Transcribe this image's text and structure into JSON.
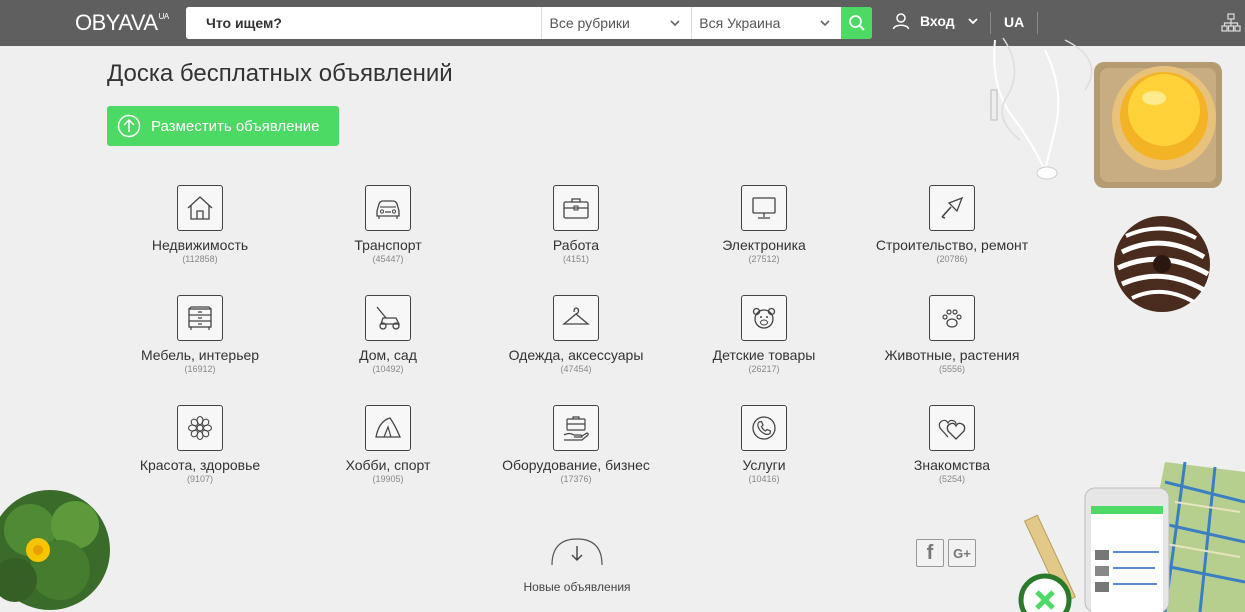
{
  "header": {
    "logo_text": "OBYAVA",
    "logo_sup": "UA",
    "search_placeholder": "Что ищем?",
    "rubric_select": "Все рубрики",
    "region_select": "Вся Украина",
    "login_label": "Вход",
    "lang_label": "UA"
  },
  "main": {
    "title": "Доска бесплатных объявлений",
    "post_button": "Разместить объявление"
  },
  "categories": [
    {
      "name": "Недвижимость",
      "count": "(112858)",
      "icon": "house-icon"
    },
    {
      "name": "Транспорт",
      "count": "(45447)",
      "icon": "car-icon"
    },
    {
      "name": "Работа",
      "count": "(4151)",
      "icon": "briefcase-icon"
    },
    {
      "name": "Электроника",
      "count": "(27512)",
      "icon": "monitor-icon"
    },
    {
      "name": "Строительство, ремонт",
      "count": "(20786)",
      "icon": "trowel-icon"
    },
    {
      "name": "Мебель, интерьер",
      "count": "(16912)",
      "icon": "dresser-icon"
    },
    {
      "name": "Дом, сад",
      "count": "(10492)",
      "icon": "lawnmower-icon"
    },
    {
      "name": "Одежда, аксессуары",
      "count": "(47454)",
      "icon": "hanger-icon"
    },
    {
      "name": "Детские товары",
      "count": "(26217)",
      "icon": "teddy-bear-icon"
    },
    {
      "name": "Животные, растения",
      "count": "(5556)",
      "icon": "paw-icon"
    },
    {
      "name": "Красота, здоровье",
      "count": "(9107)",
      "icon": "flower-icon"
    },
    {
      "name": "Хобби, спорт",
      "count": "(19905)",
      "icon": "tent-icon"
    },
    {
      "name": "Оборудование, бизнес",
      "count": "(17376)",
      "icon": "business-case-icon"
    },
    {
      "name": "Услуги",
      "count": "(10416)",
      "icon": "phone-icon"
    },
    {
      "name": "Знакомства",
      "count": "(5254)",
      "icon": "hearts-icon"
    }
  ],
  "footer": {
    "new_ads_label": "Новые объявления",
    "facebook_glyph": "f",
    "google_glyph": "G+"
  },
  "colors": {
    "header_bg": "#5f5f5f",
    "accent_green": "#4cd964",
    "page_bg": "#efefef"
  }
}
